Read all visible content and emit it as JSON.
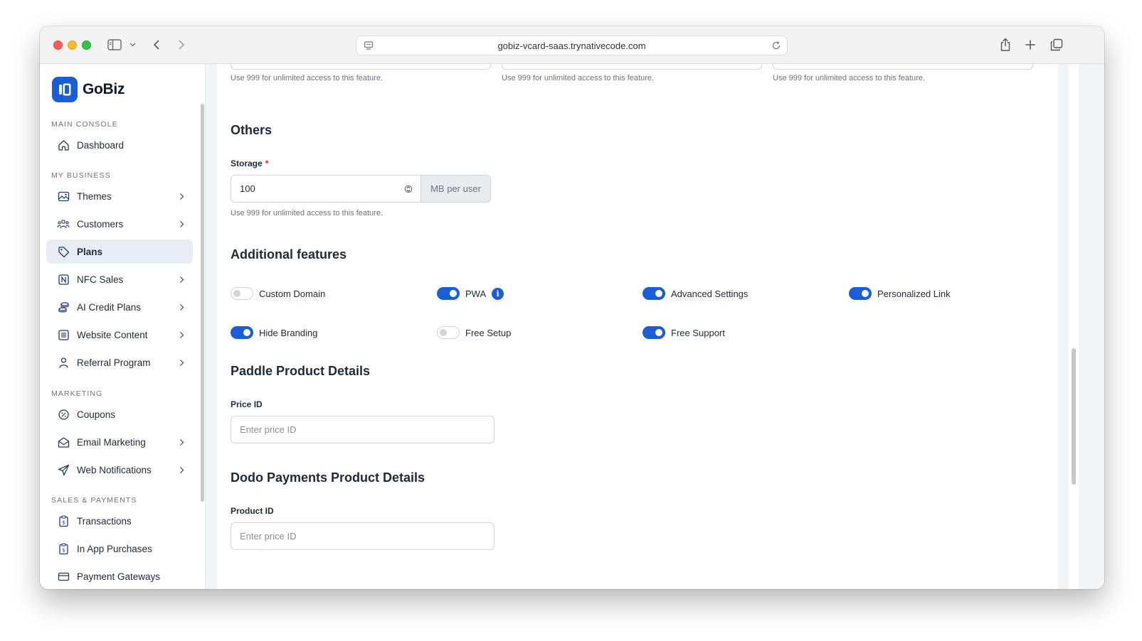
{
  "browser": {
    "url": "gobiz-vcard-saas.trynativecode.com"
  },
  "brand": {
    "name": "GoBiz",
    "accent": "#1a5dd6"
  },
  "sidebar": {
    "sections": [
      {
        "label": "MAIN CONSOLE"
      },
      {
        "label": "MY BUSINESS"
      },
      {
        "label": "MARKETING"
      },
      {
        "label": "SALES & PAYMENTS"
      }
    ],
    "items": [
      {
        "label": "Dashboard",
        "icon": "home-icon"
      },
      {
        "label": "Themes",
        "icon": "image-icon"
      },
      {
        "label": "Customers",
        "icon": "users-icon"
      },
      {
        "label": "Plans",
        "icon": "tag-icon",
        "active": true
      },
      {
        "label": "NFC Sales",
        "icon": "nfc-icon"
      },
      {
        "label": "AI Credit Plans",
        "icon": "coins-icon"
      },
      {
        "label": "Website Content",
        "icon": "content-icon"
      },
      {
        "label": "Referral Program",
        "icon": "user-icon"
      },
      {
        "label": "Coupons",
        "icon": "coupon-icon"
      },
      {
        "label": "Email Marketing",
        "icon": "mail-icon"
      },
      {
        "label": "Web Notifications",
        "icon": "send-icon"
      },
      {
        "label": "Transactions",
        "icon": "receipt-icon"
      },
      {
        "label": "In App Purchases",
        "icon": "receipt-icon"
      },
      {
        "label": "Payment Gateways",
        "icon": "card-icon"
      }
    ]
  },
  "form": {
    "top_hints": [
      "Use 999 for unlimited access to this feature.",
      "Use 999 for unlimited access to this feature.",
      "Use 999 for unlimited access to this feature."
    ],
    "others": {
      "title": "Others",
      "storage_label": "Storage",
      "required_mark": "*",
      "storage_value": "100",
      "storage_unit": "MB per user",
      "storage_hint": "Use 999 for unlimited access to this feature."
    },
    "additional": {
      "title": "Additional features",
      "toggles": [
        {
          "label": "Custom Domain",
          "on": false
        },
        {
          "label": "PWA",
          "on": true,
          "info": "i"
        },
        {
          "label": "Advanced Settings",
          "on": true
        },
        {
          "label": "Personalized Link",
          "on": true
        },
        {
          "label": "Hide Branding",
          "on": true
        },
        {
          "label": "Free Setup",
          "on": false
        },
        {
          "label": "Free Support",
          "on": true
        }
      ]
    },
    "paddle": {
      "title": "Paddle Product Details",
      "field_label": "Price ID",
      "placeholder": "Enter price ID"
    },
    "dodo": {
      "title": "Dodo Payments Product Details",
      "field_label": "Product ID",
      "placeholder": "Enter price ID"
    }
  }
}
